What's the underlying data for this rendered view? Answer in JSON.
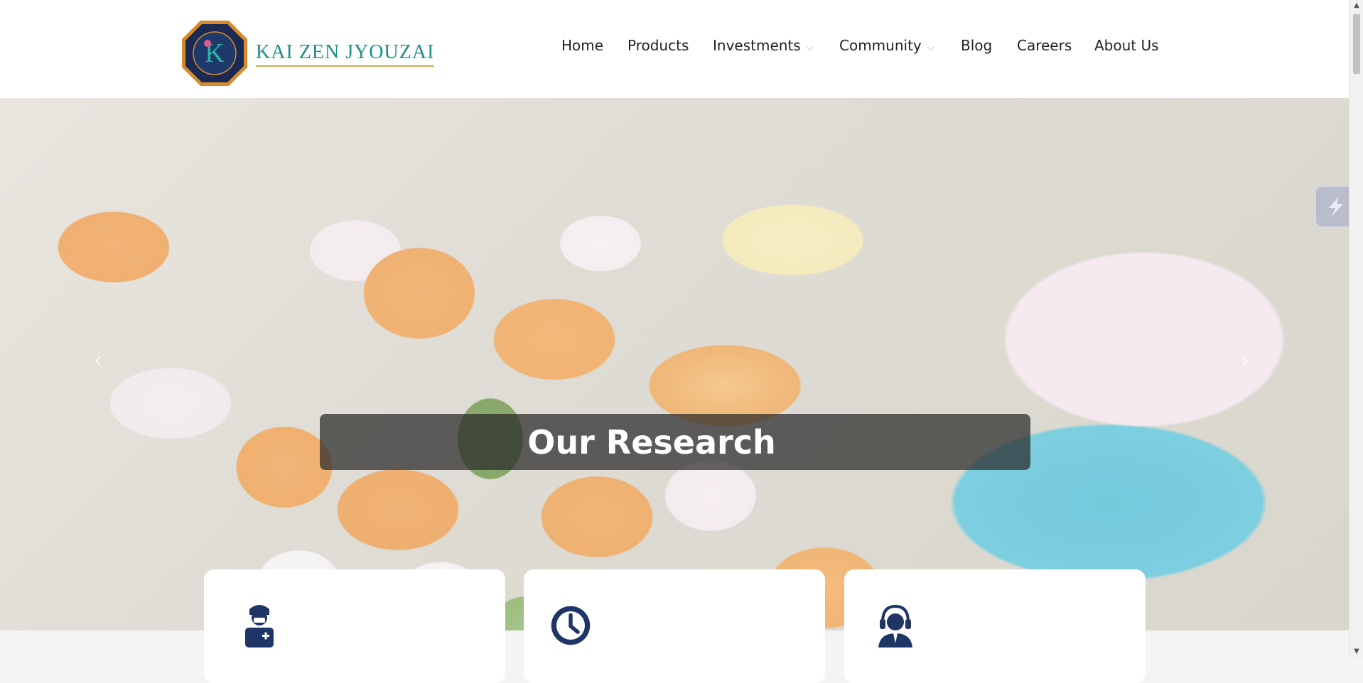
{
  "brand": {
    "name": "KAI ZEN JYOUZAI",
    "logo_letter": "K"
  },
  "nav": {
    "items": [
      {
        "label": "Home",
        "has_dropdown": false
      },
      {
        "label": "Products",
        "has_dropdown": false
      },
      {
        "label": "Investments",
        "has_dropdown": true
      },
      {
        "label": "Community",
        "has_dropdown": true
      },
      {
        "label": "Blog",
        "has_dropdown": false
      },
      {
        "label": "Careers",
        "has_dropdown": false
      },
      {
        "label": "About Us",
        "has_dropdown": false
      }
    ],
    "dropdown_glyph": "⌵"
  },
  "hero": {
    "caption": "Our Research",
    "prev_icon": "chevron-left-icon",
    "next_icon": "chevron-right-icon",
    "prev_glyph": "‹",
    "next_glyph": "›"
  },
  "cards": [
    {
      "icon": "doctor-icon"
    },
    {
      "icon": "clock-icon"
    },
    {
      "icon": "support-agent-icon"
    }
  ],
  "colors": {
    "brand_teal": "#1d8f86",
    "brand_gold": "#d8b04a",
    "icon_navy": "#1f3566",
    "caption_bg": "rgba(40,40,40,0.72)"
  }
}
